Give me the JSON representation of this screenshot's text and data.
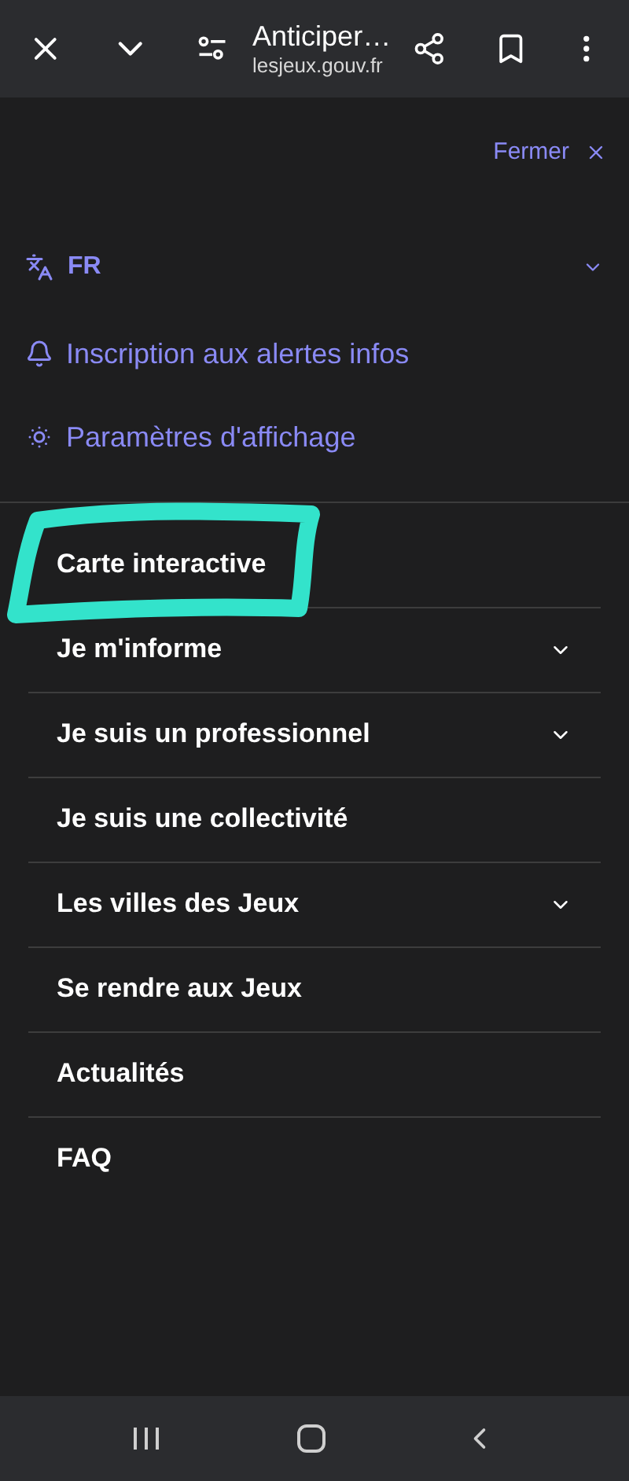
{
  "browser_bar": {
    "title": "Anticiper…",
    "url": "lesjeux.gouv.fr"
  },
  "close_menu": {
    "label": "Fermer"
  },
  "language": {
    "label": "FR",
    "expanded": false
  },
  "links": [
    {
      "kind": "alerts",
      "label": "Inscription aux alertes infos"
    },
    {
      "kind": "display",
      "label": "Paramètres d'affichage"
    }
  ],
  "menu": [
    {
      "label": "Carte interactive",
      "expandable": false,
      "circled": true
    },
    {
      "label": "Je m'informe",
      "expandable": true,
      "circled": false
    },
    {
      "label": "Je suis un professionnel",
      "expandable": true,
      "circled": false
    },
    {
      "label": "Je suis une collectivité",
      "expandable": false,
      "circled": false
    },
    {
      "label": "Les villes des Jeux",
      "expandable": true,
      "circled": false
    },
    {
      "label": "Se rendre aux Jeux",
      "expandable": false,
      "circled": false
    },
    {
      "label": "Actualités",
      "expandable": false,
      "circled": false
    },
    {
      "label": "FAQ",
      "expandable": false,
      "circled": false
    }
  ]
}
